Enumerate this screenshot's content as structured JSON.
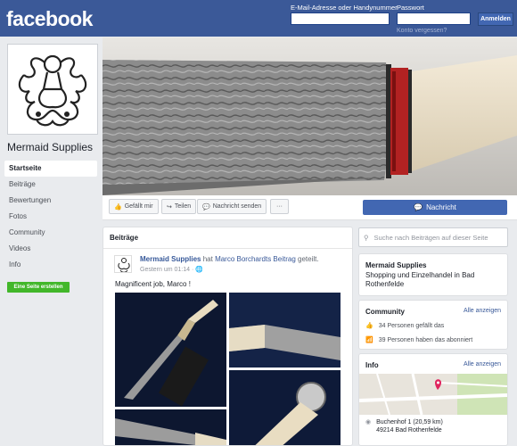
{
  "topbar": {
    "logo": "facebook",
    "email_label": "E-Mail-Adresse oder Handynummer",
    "password_label": "Passwort",
    "login_button": "Anmelden",
    "forgot_link": "Konto vergessen?"
  },
  "page": {
    "name": "Mermaid Supplies"
  },
  "sidebar": {
    "items": [
      {
        "label": "Startseite",
        "active": true
      },
      {
        "label": "Beiträge"
      },
      {
        "label": "Bewertungen"
      },
      {
        "label": "Fotos"
      },
      {
        "label": "Community"
      },
      {
        "label": "Videos"
      },
      {
        "label": "Info"
      }
    ],
    "create_page_button": "Eine Seite erstellen"
  },
  "actions": {
    "like": "Gefällt mir",
    "share": "Teilen",
    "send_message": "Nachricht senden",
    "more": "···",
    "message_button": "Nachricht"
  },
  "posts": {
    "header": "Beiträge",
    "post": {
      "author": "Mermaid Supplies",
      "verb": "hat",
      "shared_from": "Marco Borchardts Beitrag",
      "action": "geteilt.",
      "time": "Gestern um 01:14 · ",
      "text": "Magnificent job, Marco !"
    }
  },
  "right": {
    "search_placeholder": "Suche nach Beiträgen auf dieser Seite",
    "about": {
      "name": "Mermaid Supplies",
      "category": "Shopping und Einzelhandel in Bad Rothenfelde"
    },
    "community": {
      "title": "Community",
      "see_all": "Alle anzeigen",
      "likes": "34 Personen gefällt das",
      "follows": "39 Personen haben das abonniert"
    },
    "info": {
      "title": "Info",
      "see_all": "Alle anzeigen",
      "address_line1": "Buchenhof 1 (20,59 km)",
      "address_line2": "49214 Bad Rothenfelde"
    }
  },
  "colors": {
    "brand": "#3b5998",
    "button": "#4267b2",
    "create_button": "#42b72a"
  }
}
